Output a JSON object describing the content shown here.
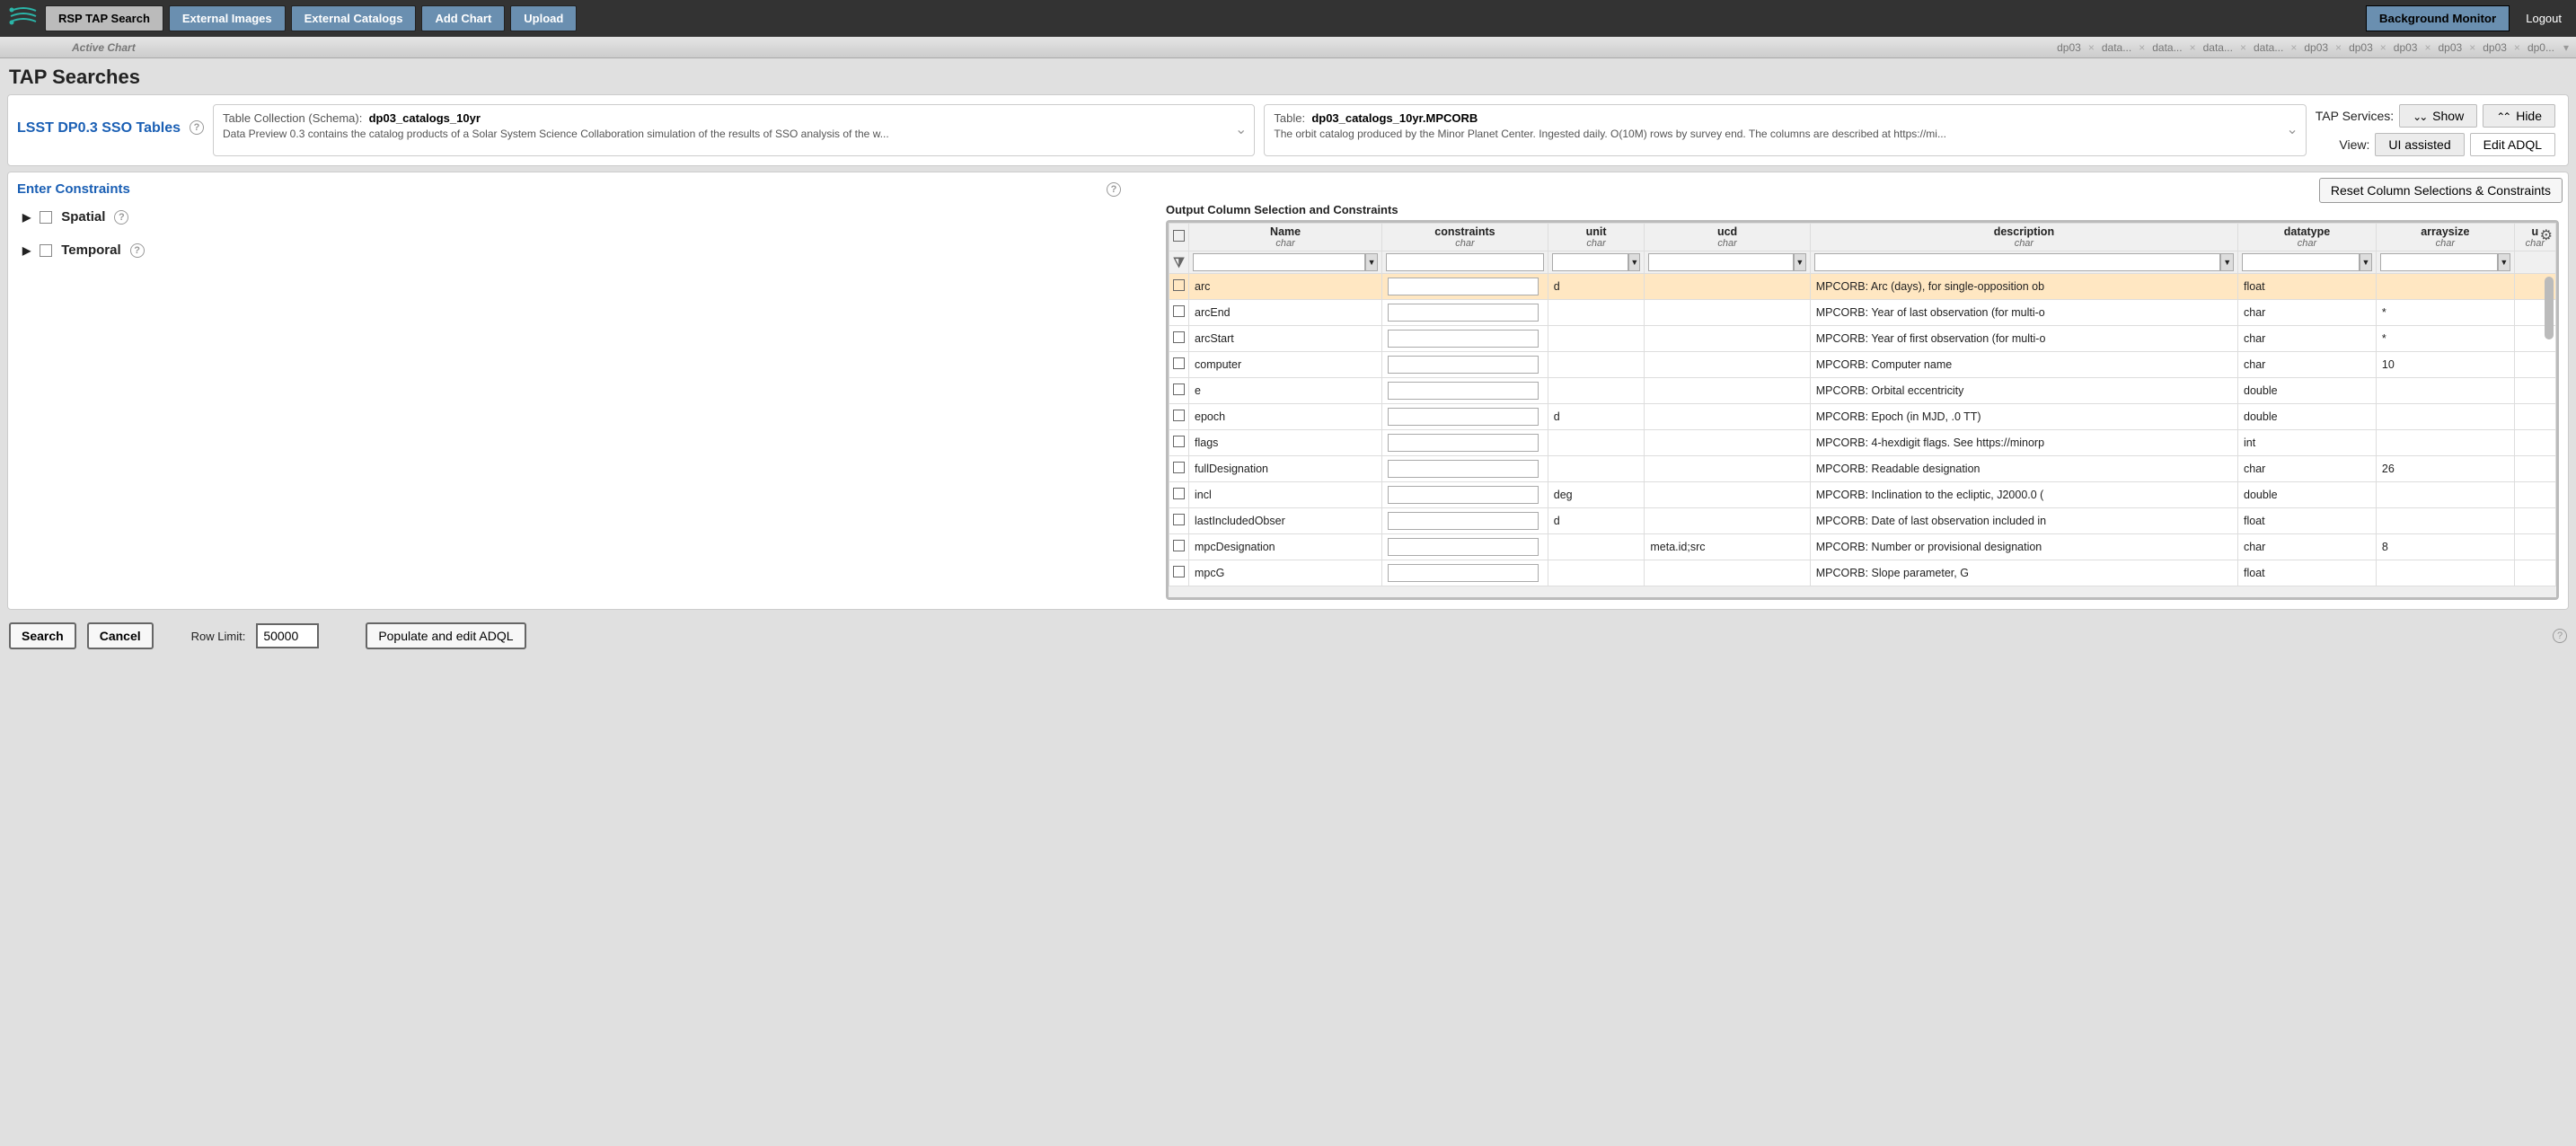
{
  "topbar": {
    "buttons": {
      "tap": "RSP TAP Search",
      "extimg": "External Images",
      "extcat": "External Catalogs",
      "addchart": "Add Chart",
      "upload": "Upload"
    },
    "bgmon": "Background Monitor",
    "logout": "Logout"
  },
  "tabstrip": {
    "activechart": "Active Chart",
    "tabs": [
      "dp03",
      "data...",
      "data...",
      "data...",
      "data...",
      "dp03",
      "dp03",
      "dp03",
      "dp03",
      "dp03",
      "dp0..."
    ]
  },
  "page_title": "TAP Searches",
  "sso": {
    "label": "LSST DP0.3 SSO Tables"
  },
  "schema_card": {
    "head_label": "Table Collection (Schema):",
    "head_value": "dp03_catalogs_10yr",
    "desc": "Data Preview 0.3 contains the catalog products of a Solar System Science Collaboration simulation of the results of SSO analysis of the w..."
  },
  "table_card": {
    "head_label": "Table:",
    "head_value": "dp03_catalogs_10yr.MPCORB",
    "desc": "The orbit catalog produced by the Minor Planet Center. Ingested daily. O(10M) rows by survey end. The columns are described at https://mi..."
  },
  "tap_services": {
    "label": "TAP Services:",
    "show": "Show",
    "hide": "Hide"
  },
  "view": {
    "label": "View:",
    "ui": "UI assisted",
    "adql": "Edit ADQL"
  },
  "constraints": {
    "enter": "Enter Constraints",
    "spatial": "Spatial",
    "temporal": "Temporal"
  },
  "reset_btn": "Reset Column Selections & Constraints",
  "oc_label": "Output Column Selection and Constraints",
  "cols": {
    "name": "Name",
    "constraints": "constraints",
    "unit": "unit",
    "ucd": "ucd",
    "desc": "description",
    "dtype": "datatype",
    "arr": "arraysize",
    "u": "u",
    "sub": "char"
  },
  "rows": [
    {
      "name": "arc",
      "unit": "d",
      "ucd": "",
      "desc": "MPCORB: Arc (days), for single-opposition ob",
      "dtype": "float",
      "arr": "",
      "hl": true
    },
    {
      "name": "arcEnd",
      "unit": "",
      "ucd": "",
      "desc": "MPCORB: Year of last observation (for multi-o",
      "dtype": "char",
      "arr": "*"
    },
    {
      "name": "arcStart",
      "unit": "",
      "ucd": "",
      "desc": "MPCORB: Year of first observation (for multi-o",
      "dtype": "char",
      "arr": "*"
    },
    {
      "name": "computer",
      "unit": "",
      "ucd": "",
      "desc": "MPCORB: Computer name",
      "dtype": "char",
      "arr": "10"
    },
    {
      "name": "e",
      "unit": "",
      "ucd": "",
      "desc": "MPCORB: Orbital eccentricity",
      "dtype": "double",
      "arr": ""
    },
    {
      "name": "epoch",
      "unit": "d",
      "ucd": "",
      "desc": "MPCORB: Epoch (in MJD, .0 TT)",
      "dtype": "double",
      "arr": ""
    },
    {
      "name": "flags",
      "unit": "",
      "ucd": "",
      "desc": "MPCORB: 4-hexdigit flags. See https://minorp",
      "dtype": "int",
      "arr": ""
    },
    {
      "name": "fullDesignation",
      "unit": "",
      "ucd": "",
      "desc": "MPCORB: Readable designation",
      "dtype": "char",
      "arr": "26"
    },
    {
      "name": "incl",
      "unit": "deg",
      "ucd": "",
      "desc": "MPCORB: Inclination to the ecliptic, J2000.0 (",
      "dtype": "double",
      "arr": ""
    },
    {
      "name": "lastIncludedObser",
      "unit": "d",
      "ucd": "",
      "desc": "MPCORB: Date of last observation included in",
      "dtype": "float",
      "arr": ""
    },
    {
      "name": "mpcDesignation",
      "unit": "",
      "ucd": "meta.id;src",
      "desc": "MPCORB: Number or provisional designation",
      "dtype": "char",
      "arr": "8"
    },
    {
      "name": "mpcG",
      "unit": "",
      "ucd": "",
      "desc": "MPCORB: Slope parameter, G",
      "dtype": "float",
      "arr": ""
    }
  ],
  "footer": {
    "search": "Search",
    "cancel": "Cancel",
    "rowlimit_label": "Row Limit:",
    "rowlimit_value": "50000",
    "populate": "Populate and edit ADQL"
  }
}
